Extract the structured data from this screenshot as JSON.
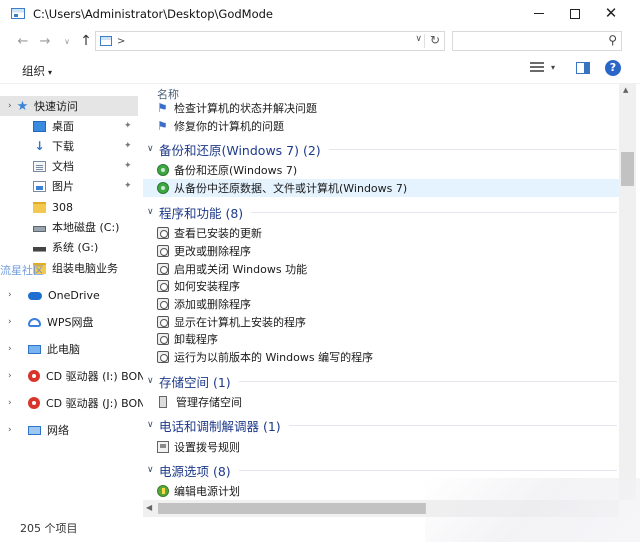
{
  "window": {
    "title": "C:\\Users\\Administrator\\Desktop\\GodMode",
    "minimize": "—",
    "close": "✕"
  },
  "nav": {
    "back": "←",
    "forward": "→",
    "recent": "∨",
    "up": "↑",
    "address_separator": ">",
    "address_dropdown": "∨",
    "refresh": "↻",
    "search_placeholder": "",
    "search_icon": "⚲"
  },
  "command_bar": {
    "organize_label": "组织",
    "organize_caret": "▾",
    "view_caret": "▾",
    "help": "?"
  },
  "sidebar": {
    "items": [
      {
        "label": "快速访问",
        "icon": "star-icon",
        "chev": "›",
        "selected": true
      },
      {
        "label": "桌面",
        "icon": "desktop-icon",
        "pinned": true
      },
      {
        "label": "下载",
        "icon": "download-icon",
        "glyph": "↓",
        "pinned": true
      },
      {
        "label": "文档",
        "icon": "documents-icon",
        "pinned": true
      },
      {
        "label": "图片",
        "icon": "pictures-icon",
        "pinned": true
      },
      {
        "label": "308",
        "icon": "folder-icon"
      },
      {
        "label": "本地磁盘 (C:)",
        "icon": "drive-icon"
      },
      {
        "label": "系统 (G:)",
        "icon": "drive-icon"
      },
      {
        "label": "组装电脑业务",
        "icon": "folder-icon"
      },
      {
        "label": "OneDrive",
        "icon": "cloud-icon",
        "chev": "›"
      },
      {
        "label": "WPS网盘",
        "icon": "wps-cloud-icon",
        "chev": "›"
      },
      {
        "label": "此电脑",
        "icon": "computer-icon",
        "chev": "›"
      },
      {
        "label": "CD 驱动器 (I:) BON.",
        "icon": "cd-drive-icon",
        "chev": "›"
      },
      {
        "label": "CD 驱动器 (J:) BON.",
        "icon": "cd-drive-icon",
        "chev": "›"
      },
      {
        "label": "网络",
        "icon": "network-icon",
        "chev": "›"
      }
    ],
    "pin_glyph": "📌",
    "watermark": "流星社区"
  },
  "main": {
    "column_header": "名称",
    "rows": [
      {
        "type": "item",
        "label": "检查计算机的状态并解决问题",
        "icon": "flag-icon"
      },
      {
        "type": "item",
        "label": "修复你的计算机的问题",
        "icon": "flag-icon"
      },
      {
        "type": "group",
        "label": "备份和还原(Windows 7) (2)"
      },
      {
        "type": "item",
        "label": "备份和还原(Windows 7)",
        "icon": "backup-icon"
      },
      {
        "type": "item",
        "label": "从备份中还原数据、文件或计算机(Windows 7)",
        "icon": "backup-icon",
        "hover": true
      },
      {
        "type": "group",
        "label": "程序和功能 (8)"
      },
      {
        "type": "item",
        "label": "查看已安装的更新",
        "icon": "programs-icon"
      },
      {
        "type": "item",
        "label": "更改或删除程序",
        "icon": "programs-icon"
      },
      {
        "type": "item",
        "label": "启用或关闭 Windows 功能",
        "icon": "programs-icon"
      },
      {
        "type": "item",
        "label": "如何安装程序",
        "icon": "programs-icon"
      },
      {
        "type": "item",
        "label": "添加或删除程序",
        "icon": "programs-icon"
      },
      {
        "type": "item",
        "label": "显示在计算机上安装的程序",
        "icon": "programs-icon"
      },
      {
        "type": "item",
        "label": "卸载程序",
        "icon": "programs-icon"
      },
      {
        "type": "item",
        "label": "运行为以前版本的 Windows 编写的程序",
        "icon": "programs-icon"
      },
      {
        "type": "group",
        "label": "存储空间 (1)"
      },
      {
        "type": "item",
        "label": "管理存储空间",
        "icon": "storage-icon"
      },
      {
        "type": "group",
        "label": "电话和调制解调器 (1)"
      },
      {
        "type": "item",
        "label": "设置拨号规则",
        "icon": "phone-icon"
      },
      {
        "type": "group",
        "label": "电源选项 (8)"
      },
      {
        "type": "item",
        "label": "编辑电源计划",
        "icon": "power-icon"
      }
    ],
    "group_chev": "∨",
    "flag_glyph": "⚑"
  },
  "scrollbars": {
    "up": "▲",
    "left": "◀"
  },
  "status": {
    "item_count": "205 个项目"
  }
}
